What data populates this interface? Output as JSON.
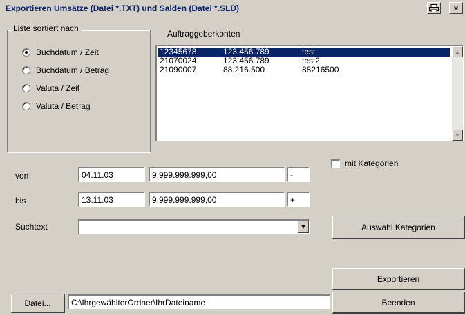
{
  "window": {
    "title": "Exportieren Umsätze (Datei *.TXT) und Salden (Datei *.SLD)",
    "print_icon": "printer-icon",
    "close_label": "×"
  },
  "sort_group": {
    "legend": "Liste sortiert nach",
    "options": [
      {
        "label": "Buchdatum / Zeit",
        "checked": true
      },
      {
        "label": "Buchdatum / Betrag",
        "checked": false
      },
      {
        "label": "Valuta / Zeit",
        "checked": false
      },
      {
        "label": "Valuta / Betrag",
        "checked": false
      }
    ]
  },
  "accounts": {
    "label": "Auftraggeberkonten",
    "rows": [
      {
        "account": "12345678",
        "amount": "123.456.789",
        "name": "test",
        "selected": true
      },
      {
        "account": "21070024",
        "amount": "123.456.789",
        "name": "test2",
        "selected": false
      },
      {
        "account": "21090007",
        "amount": "88.216.500",
        "name": "88216500",
        "selected": false
      }
    ]
  },
  "filters": {
    "von_label": "von",
    "von_date": "04.11.03",
    "von_amount": "9.999.999.999,00",
    "von_sign": "-",
    "bis_label": "bis",
    "bis_date": "13.11.03",
    "bis_amount": "9.999.999.999,00",
    "bis_sign": "+",
    "search_label": "Suchtext",
    "search_value": ""
  },
  "categories": {
    "checkbox_label": "mit Kategorien",
    "checked": false,
    "select_button": "Auswahl Kategorien"
  },
  "actions": {
    "export_button": "Exportieren",
    "close_button": "Beenden",
    "file_button": "Datei...",
    "file_path": "C:\\IhrgewählterOrdner\\IhrDateiname"
  }
}
